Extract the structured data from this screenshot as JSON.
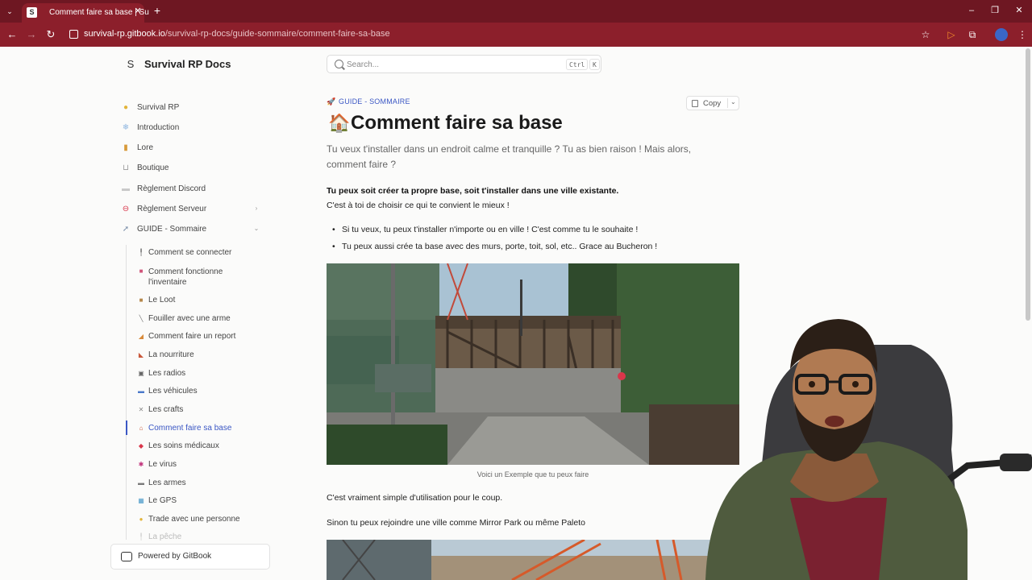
{
  "browser": {
    "tab_title": "Comment faire sa base | Su",
    "tab_favicon": "S",
    "url_host": "survival-rp.gitbook.io",
    "url_path": "/survival-rp-docs/guide-sommaire/comment-faire-sa-base",
    "accent_color": "#8c1f2b"
  },
  "site": {
    "title": "Survival RP Docs",
    "logo": "S",
    "search_placeholder": "Search...",
    "search_kbd_1": "Ctrl",
    "search_kbd_2": "K"
  },
  "sidebar": {
    "items": [
      {
        "label": "Survival RP",
        "icon": "sun-icon"
      },
      {
        "label": "Introduction",
        "icon": "snowflake-icon"
      },
      {
        "label": "Lore",
        "icon": "book-icon"
      },
      {
        "label": "Boutique",
        "icon": "cart-icon"
      },
      {
        "label": "Règlement Discord",
        "icon": "discord-icon"
      },
      {
        "label": "Règlement Serveur",
        "icon": "no-entry-icon"
      },
      {
        "label": "GUIDE - Sommaire",
        "icon": "rocket-icon"
      }
    ],
    "sub_items": [
      {
        "label": "Comment se connecter",
        "icon": "pin-icon"
      },
      {
        "label": "Comment fonctionne l'inventaire",
        "icon": "backpack-icon"
      },
      {
        "label": "Le Loot",
        "icon": "box-icon"
      },
      {
        "label": "Fouiller avec une arme",
        "icon": "knife-icon"
      },
      {
        "label": "Comment faire un report",
        "icon": "megaphone-icon"
      },
      {
        "label": "La nourriture",
        "icon": "food-icon"
      },
      {
        "label": "Les radios",
        "icon": "radio-icon"
      },
      {
        "label": "Les véhicules",
        "icon": "car-icon"
      },
      {
        "label": "Les crafts",
        "icon": "tools-icon"
      },
      {
        "label": "Comment faire sa base",
        "icon": "house-icon"
      },
      {
        "label": "Les soins médicaux",
        "icon": "pill-icon"
      },
      {
        "label": "Le virus",
        "icon": "virus-icon"
      },
      {
        "label": "Les armes",
        "icon": "gun-icon"
      },
      {
        "label": "Le GPS",
        "icon": "map-icon"
      },
      {
        "label": "Trade avec une personne",
        "icon": "handshake-icon"
      },
      {
        "label": "La pêche",
        "icon": "fishing-icon"
      }
    ],
    "powered_by": "Powered by GitBook"
  },
  "content": {
    "breadcrumb": "GUIDE - SOMMAIRE",
    "copy_label": "Copy",
    "title": "Comment faire sa base",
    "lead": "Tu veux t'installer dans un endroit calme et tranquille ? Tu as bien raison ! Mais alors, comment faire ?",
    "bold_line": "Tu peux soit créer ta propre base, soit t'installer dans une ville existante.",
    "line_2": "C'est à toi de choisir ce qui te convient le mieux !",
    "bullets": [
      "Si tu veux, tu peux t'installer n'importe ou en ville ! C'est comme tu le souhaite !",
      "Tu peux aussi crée ta base avec des murs, porte, toit, sol, etc.. Grace au Bucheron !"
    ],
    "caption": "Voici un Exemple que tu peux faire",
    "para_1": "C'est vraiment simple d'utilisation pour le coup.",
    "para_2": "Sinon tu peux rejoindre une ville comme Mirror Park ou même Paleto"
  }
}
